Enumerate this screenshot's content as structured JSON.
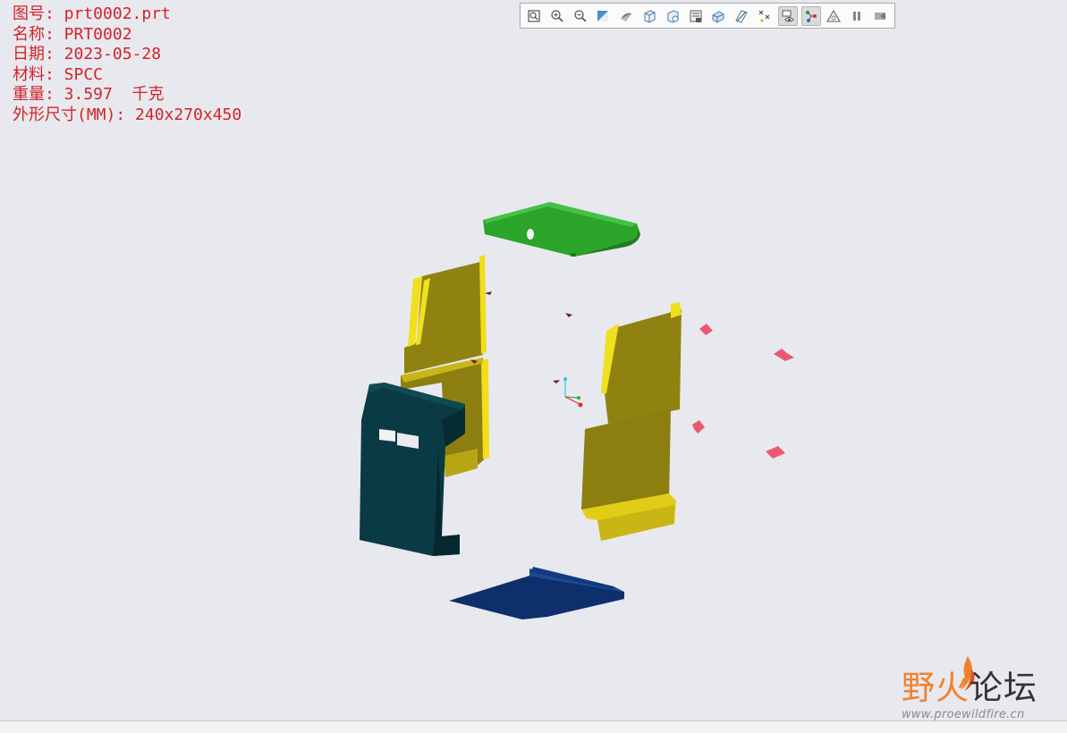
{
  "info": {
    "drawing_no": "图号: prt0002.prt",
    "name": "名称: PRT0002",
    "date": "日期: 2023-05-28",
    "material": "材料: SPCC",
    "weight": "重量: 3.597  千克",
    "dimensions": "外形尺寸(MM): 240x270x450"
  },
  "toolbar": {
    "buttons": [
      {
        "icon": "refit-icon",
        "active": false
      },
      {
        "icon": "zoom-in-icon",
        "active": false
      },
      {
        "icon": "zoom-out-icon",
        "active": false
      },
      {
        "icon": "repaint-icon",
        "active": false
      },
      {
        "icon": "display-style-icon",
        "active": false
      },
      {
        "icon": "saved-orientations-icon",
        "active": false
      },
      {
        "icon": "view-manager-icon",
        "active": false
      },
      {
        "icon": "section-icon",
        "active": false
      },
      {
        "icon": "perspective-icon",
        "active": false
      },
      {
        "icon": "datum-display-icon",
        "active": false
      },
      {
        "icon": "point-display-icon",
        "active": false
      },
      {
        "icon": "annotation-display-icon",
        "active": true
      },
      {
        "icon": "spin-center-icon",
        "active": true
      },
      {
        "icon": "triangle-icon",
        "active": false
      },
      {
        "icon": "pause-icon",
        "active": false
      },
      {
        "icon": "next-icon",
        "active": false
      }
    ]
  },
  "watermark": {
    "title_part1": "野火",
    "title_part2": "论坛",
    "url": "www.proewildfire.cn"
  },
  "colors": {
    "background": "#e8e9ee",
    "info_text": "#d2232a",
    "top_plate": "#2aa52a",
    "side_panel": "#8c7f10",
    "side_edge": "#e8d81a",
    "front_panel": "#0a3a44",
    "bottom_plate": "#0d2f6c",
    "small_tab": "#e95a72",
    "wm_orange": "#f0822d",
    "wm_dark": "#333333"
  }
}
